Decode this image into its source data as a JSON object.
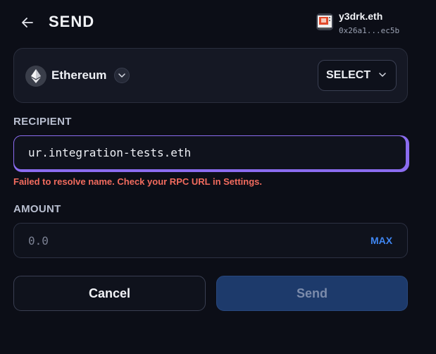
{
  "header": {
    "title": "SEND",
    "back_icon": "arrow-left-icon"
  },
  "account": {
    "name": "y3drk.eth",
    "address": "0x26a1...ec5b",
    "avatar_icon": "account-avatar-icon"
  },
  "network": {
    "name": "Ethereum",
    "logo_icon": "ethereum-icon",
    "select_label": "SELECT"
  },
  "recipient": {
    "label": "RECIPIENT",
    "value": "ur.integration-tests.eth",
    "error": "Failed to resolve name. Check your RPC URL in Settings."
  },
  "amount": {
    "label": "AMOUNT",
    "placeholder": "0.0",
    "max_label": "MAX"
  },
  "actions": {
    "cancel_label": "Cancel",
    "send_label": "Send"
  },
  "colors": {
    "background": "#0c0e17",
    "accent_border": "#8b6cf0",
    "error": "#f26b5e",
    "link": "#3f86f2",
    "send_disabled": "#1d3a6b"
  }
}
